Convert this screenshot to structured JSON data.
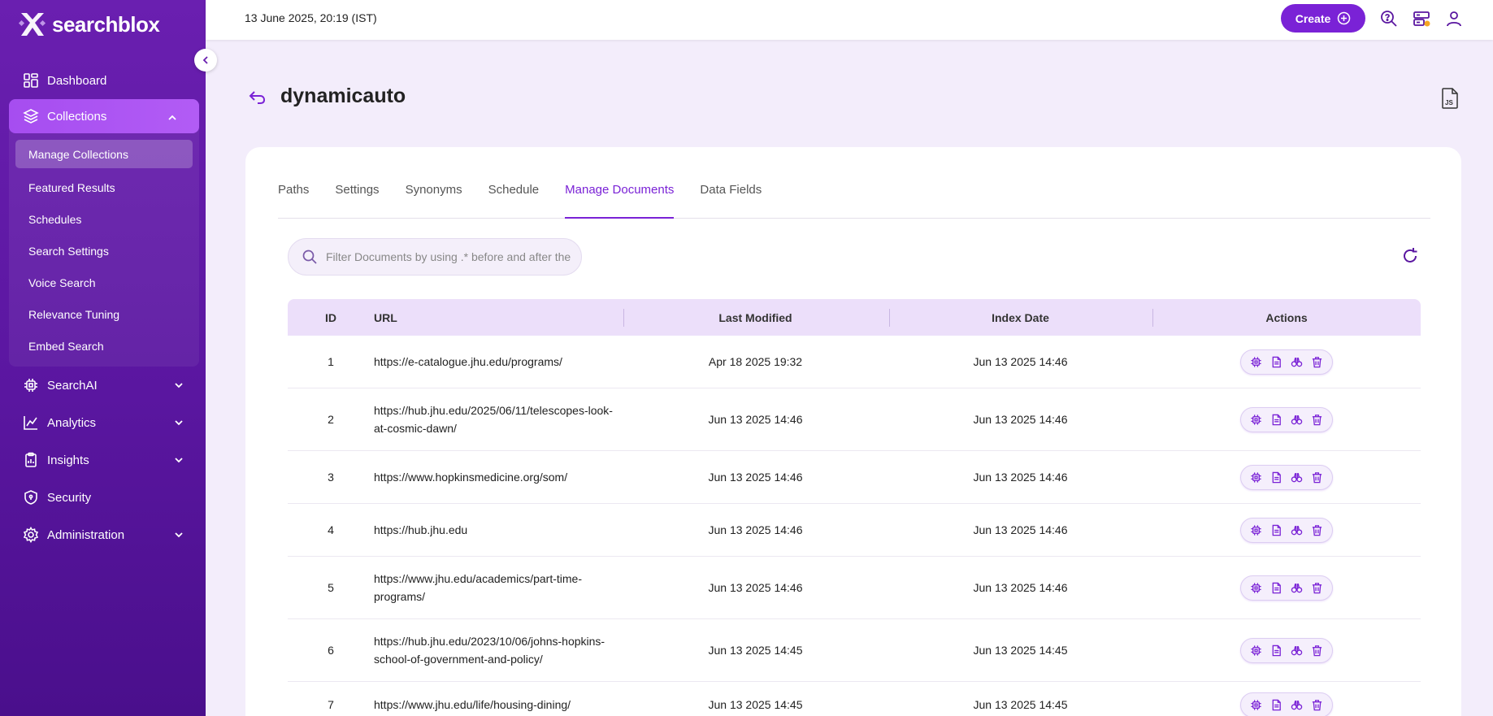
{
  "app": {
    "brand": "searchblox",
    "datetime": "13 June 2025, 20:19 (IST)",
    "create_label": "Create"
  },
  "sidebar": {
    "items": [
      {
        "label": "Dashboard",
        "icon": "dashboard-icon"
      },
      {
        "label": "Collections",
        "icon": "layers-icon",
        "active": true
      },
      {
        "label": "SearchAI",
        "icon": "chip-icon"
      },
      {
        "label": "Analytics",
        "icon": "analytics-icon"
      },
      {
        "label": "Insights",
        "icon": "clipboard-icon"
      },
      {
        "label": "Security",
        "icon": "shield-icon"
      },
      {
        "label": "Administration",
        "icon": "gear-icon"
      }
    ],
    "collections_sub": [
      "Manage Collections",
      "Featured Results",
      "Schedules",
      "Search Settings",
      "Voice Search",
      "Relevance Tuning",
      "Embed Search"
    ]
  },
  "page": {
    "title": "dynamicauto"
  },
  "tabs": [
    "Paths",
    "Settings",
    "Synonyms",
    "Schedule",
    "Manage Documents",
    "Data Fields"
  ],
  "active_tab": "Manage Documents",
  "search": {
    "placeholder": "Filter Documents by using .* before and after the"
  },
  "table": {
    "headers": {
      "id": "ID",
      "url": "URL",
      "modified": "Last Modified",
      "index": "Index Date",
      "actions": "Actions"
    },
    "rows": [
      {
        "id": "1",
        "url": "https://e-catalogue.jhu.edu/programs/",
        "modified": "Apr 18 2025 19:32",
        "index": "Jun 13 2025 14:46"
      },
      {
        "id": "2",
        "url": "https://hub.jhu.edu/2025/06/11/telescopes-look-at-cosmic-dawn/",
        "modified": "Jun 13 2025 14:46",
        "index": "Jun 13 2025 14:46"
      },
      {
        "id": "3",
        "url": "https://www.hopkinsmedicine.org/som/",
        "modified": "Jun 13 2025 14:46",
        "index": "Jun 13 2025 14:46"
      },
      {
        "id": "4",
        "url": "https://hub.jhu.edu",
        "modified": "Jun 13 2025 14:46",
        "index": "Jun 13 2025 14:46"
      },
      {
        "id": "5",
        "url": "https://www.jhu.edu/academics/part-time-programs/",
        "modified": "Jun 13 2025 14:46",
        "index": "Jun 13 2025 14:46"
      },
      {
        "id": "6",
        "url": "https://hub.jhu.edu/2023/10/06/johns-hopkins-school-of-government-and-policy/",
        "modified": "Jun 13 2025 14:45",
        "index": "Jun 13 2025 14:45"
      },
      {
        "id": "7",
        "url": "https://www.jhu.edu/life/housing-dining/",
        "modified": "Jun 13 2025 14:45",
        "index": "Jun 13 2025 14:45"
      }
    ]
  },
  "colors": {
    "accent": "#7a22d6",
    "sidebar": "#5a16a0",
    "notification": "#f5a623"
  }
}
